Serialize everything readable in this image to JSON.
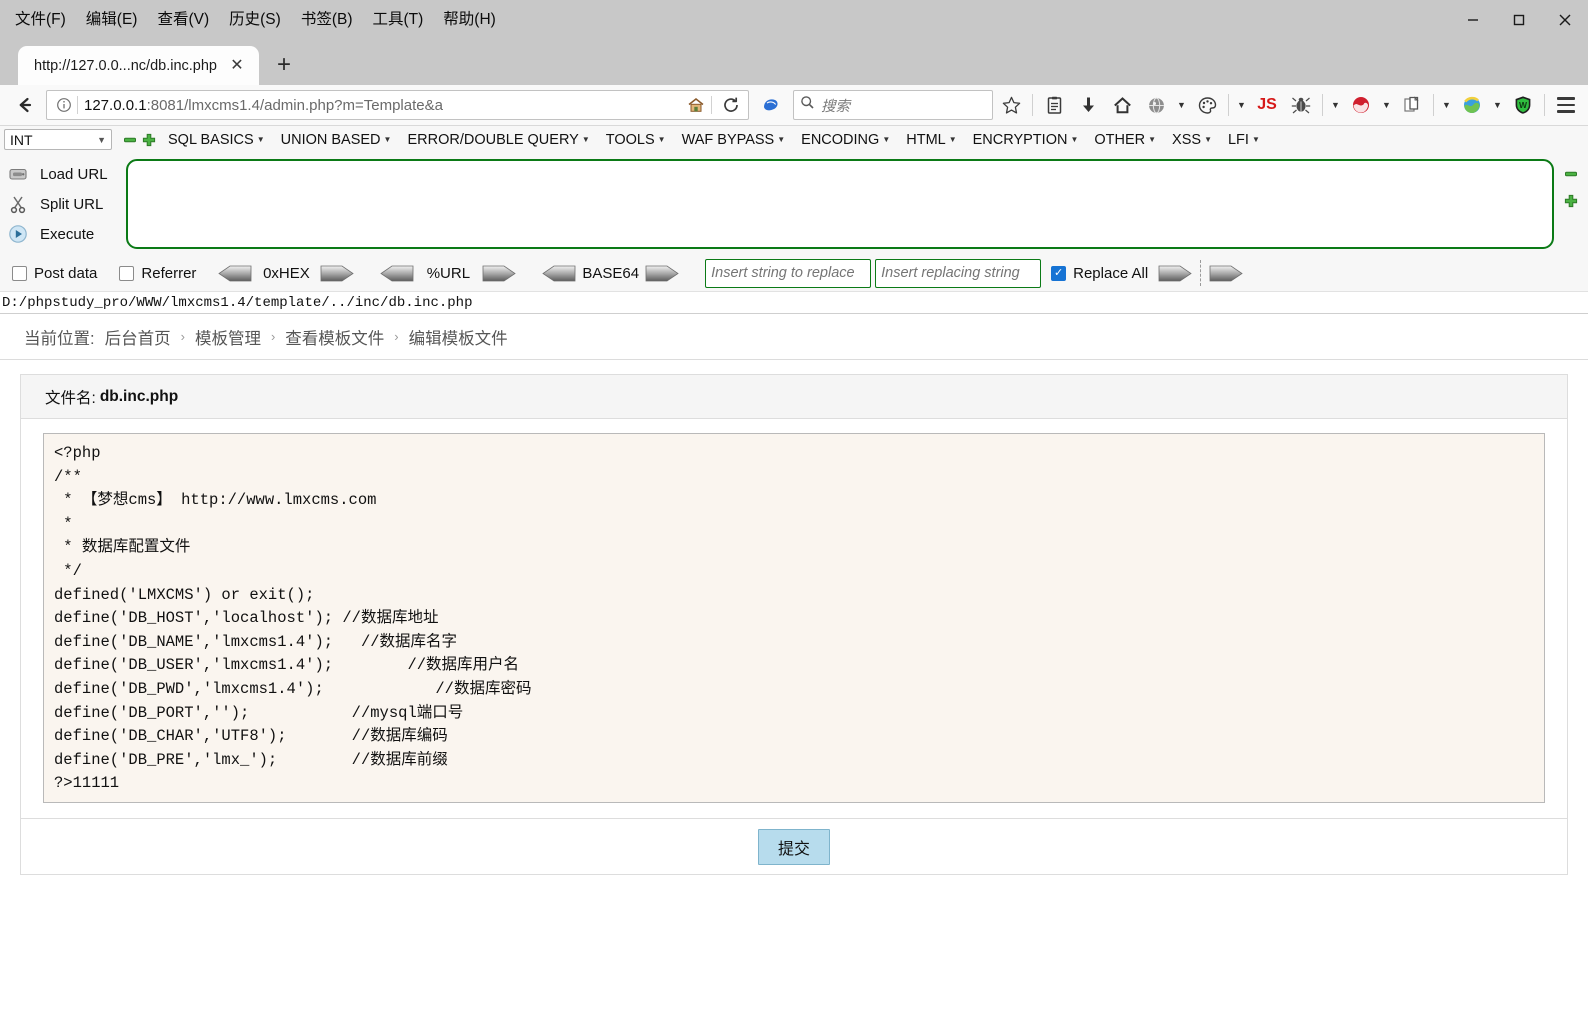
{
  "window": {
    "menus": [
      {
        "label": "文件(F)",
        "accel": "F"
      },
      {
        "label": "编辑(E)",
        "accel": "E"
      },
      {
        "label": "查看(V)",
        "accel": "V"
      },
      {
        "label": "历史(S)",
        "accel": "S"
      },
      {
        "label": "书签(B)",
        "accel": "B"
      },
      {
        "label": "工具(T)",
        "accel": "T"
      },
      {
        "label": "帮助(H)",
        "accel": "H"
      }
    ],
    "controls": {
      "minimize": "—",
      "maximize": "□",
      "close": "✕"
    }
  },
  "tabs": {
    "items": [
      {
        "title": "http://127.0.0...nc/db.inc.php",
        "close": "✕"
      }
    ],
    "new_tab": "+"
  },
  "navbar": {
    "back": "←",
    "url_host": "127.0.0.1",
    "url_rest": ":8081/lmxcms1.4/admin.php?m=Template&a",
    "url_full": "127.0.0.1:8081/lmxcms1.4/admin.php?m=Template&a",
    "search_placeholder": "搜索",
    "js_label": "JS"
  },
  "hackbar": {
    "type_select": "INT",
    "menus": [
      "SQL BASICS",
      "UNION BASED",
      "ERROR/DOUBLE QUERY",
      "TOOLS",
      "WAF BYPASS",
      "ENCODING",
      "HTML",
      "ENCRYPTION",
      "OTHER",
      "XSS",
      "LFI"
    ],
    "actions": [
      {
        "label": "Load URL",
        "icon": "load-url-icon"
      },
      {
        "label": "Split URL",
        "icon": "split-url-icon"
      },
      {
        "label": "Execute",
        "icon": "execute-icon"
      }
    ],
    "textarea_value": "",
    "checkboxes": [
      {
        "label": "Post data",
        "checked": false
      },
      {
        "label": "Referrer",
        "checked": false
      }
    ],
    "encoders": [
      "0xHEX",
      "%URL",
      "BASE64"
    ],
    "replace_from_placeholder": "Insert string to replace",
    "replace_to_placeholder": "Insert replacing string",
    "replace_all": {
      "label": "Replace All",
      "checked": true
    }
  },
  "path_line": "D:/phpstudy_pro/WWW/lmxcms1.4/template/../inc/db.inc.php",
  "breadcrumb": {
    "prefix": "当前位置:",
    "items": [
      "后台首页",
      "模板管理",
      "查看模板文件",
      "编辑模板文件"
    ],
    "separator": "›"
  },
  "editor": {
    "filename_label": "文件名:",
    "filename": "db.inc.php",
    "code": "<?php\n/**\n * 【梦想cms】 http://www.lmxcms.com\n *\n * 数据库配置文件\n */\ndefined('LMXCMS') or exit();\ndefine('DB_HOST','localhost'); //数据库地址\ndefine('DB_NAME','lmxcms1.4');   //数据库名字\ndefine('DB_USER','lmxcms1.4');        //数据库用户名\ndefine('DB_PWD','lmxcms1.4');            //数据库密码\ndefine('DB_PORT','');           //mysql端口号\ndefine('DB_CHAR','UTF8');       //数据库编码\ndefine('DB_PRE','lmx_');        //数据库前缀\n?>11111",
    "submit_label": "提交"
  },
  "colors": {
    "hackbar_green": "#0b7a16",
    "checkbox_blue": "#1673d4",
    "code_bg": "#faf5ef",
    "submit_bg": "#b7dced",
    "titlebar_bg": "#c8c8c8"
  }
}
